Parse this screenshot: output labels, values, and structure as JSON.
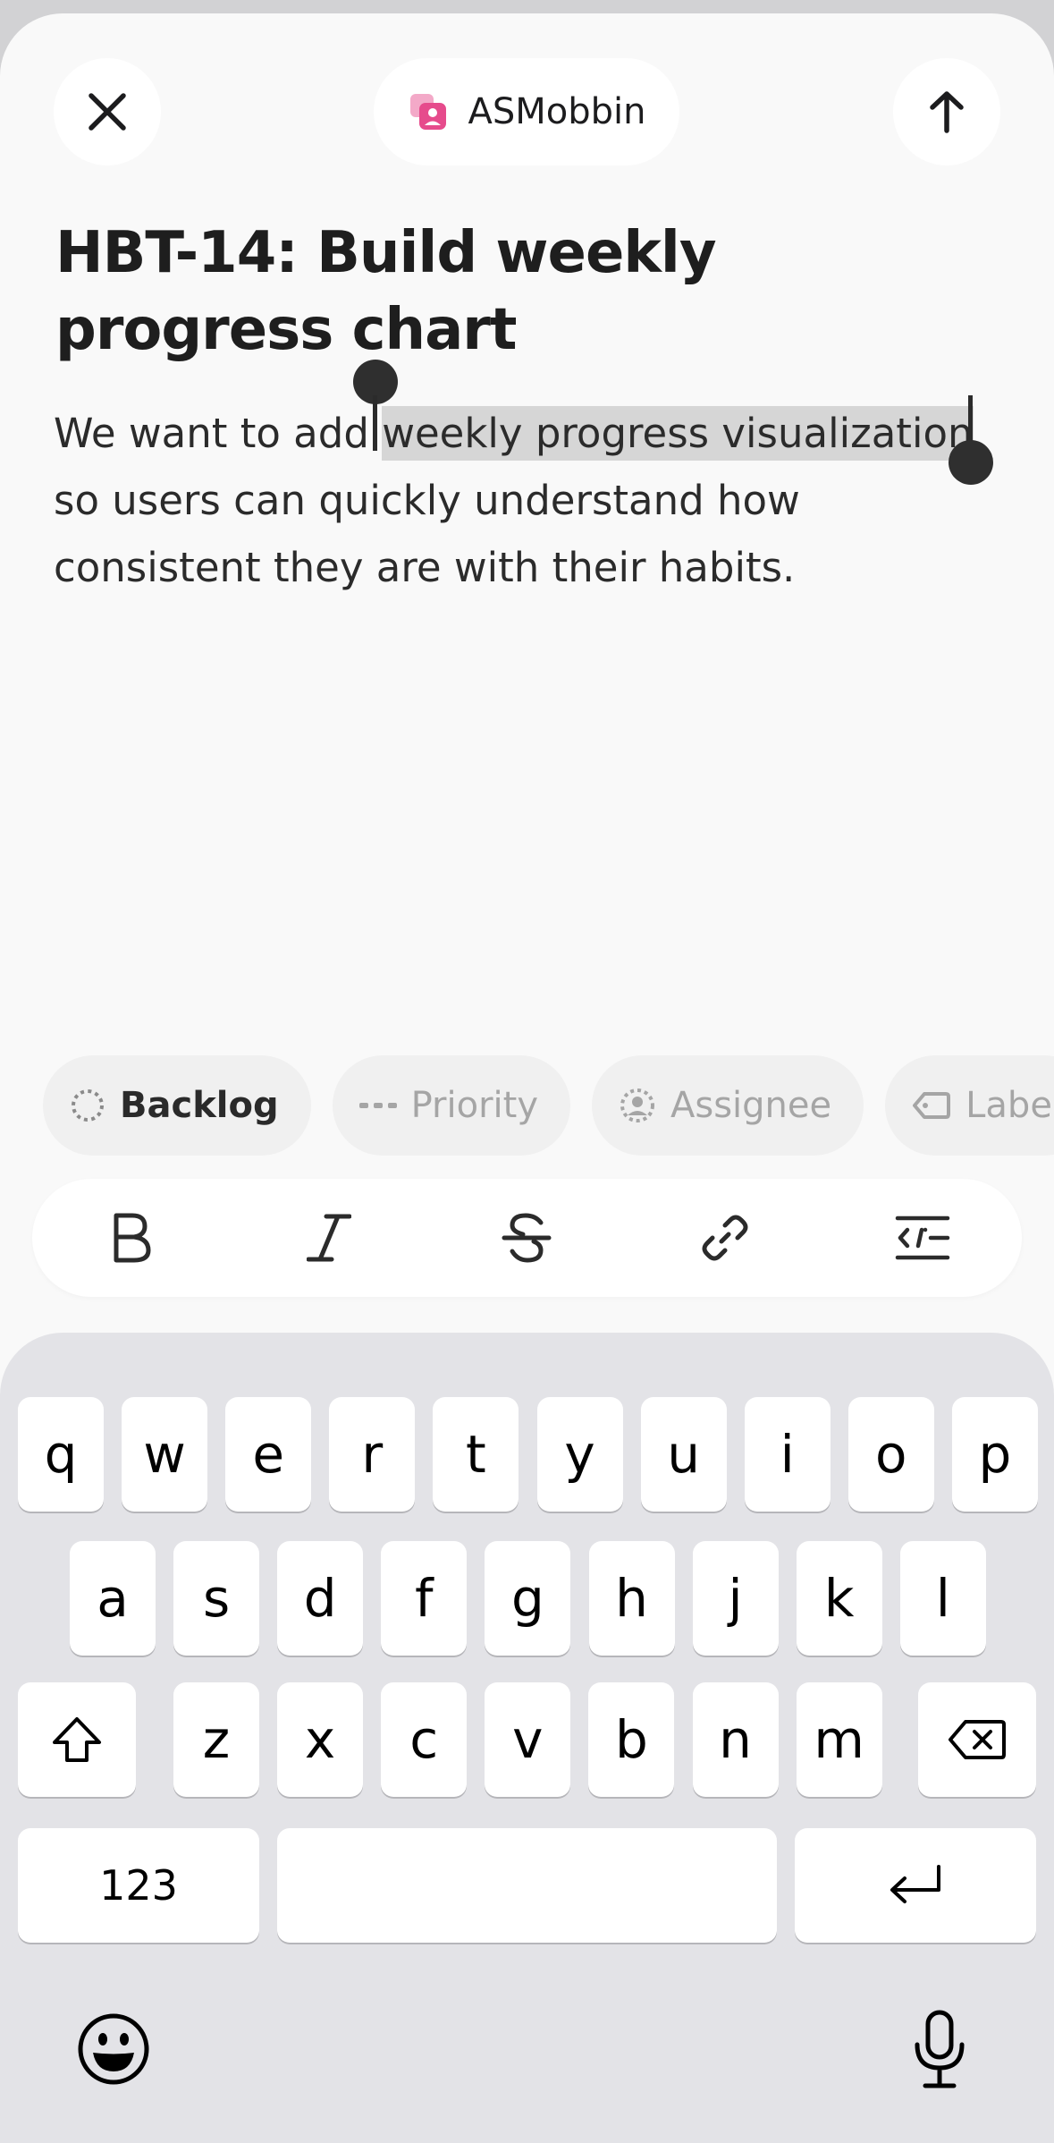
{
  "header": {
    "team_name": "ASMobbin",
    "close_icon": "close-icon",
    "submit_icon": "arrow-up-icon",
    "team_icon_color": "#e64b8c"
  },
  "issue": {
    "title": "HBT-14: Build weekly progress chart",
    "description_before": "We want to add ",
    "description_selected": "weekly progress visualization",
    "description_after": " so users can quickly understand how consistent they are with their habits."
  },
  "properties": {
    "status": "Backlog",
    "priority": "Priority",
    "assignee": "Assignee",
    "label": "Label"
  },
  "formatting": {
    "bold_icon": "bold-icon",
    "italic_icon": "italic-icon",
    "strikethrough_icon": "strikethrough-icon",
    "link_icon": "link-icon",
    "code_icon": "code-block-icon"
  },
  "keyboard": {
    "row1": [
      "q",
      "w",
      "e",
      "r",
      "t",
      "y",
      "u",
      "i",
      "o",
      "p"
    ],
    "row2": [
      "a",
      "s",
      "d",
      "f",
      "g",
      "h",
      "j",
      "k",
      "l"
    ],
    "row3": [
      "z",
      "x",
      "c",
      "v",
      "b",
      "n",
      "m"
    ],
    "numbers_label": "123",
    "space_label": "",
    "colors": {
      "background": "#e3e3e7",
      "key": "#ffffff"
    }
  }
}
